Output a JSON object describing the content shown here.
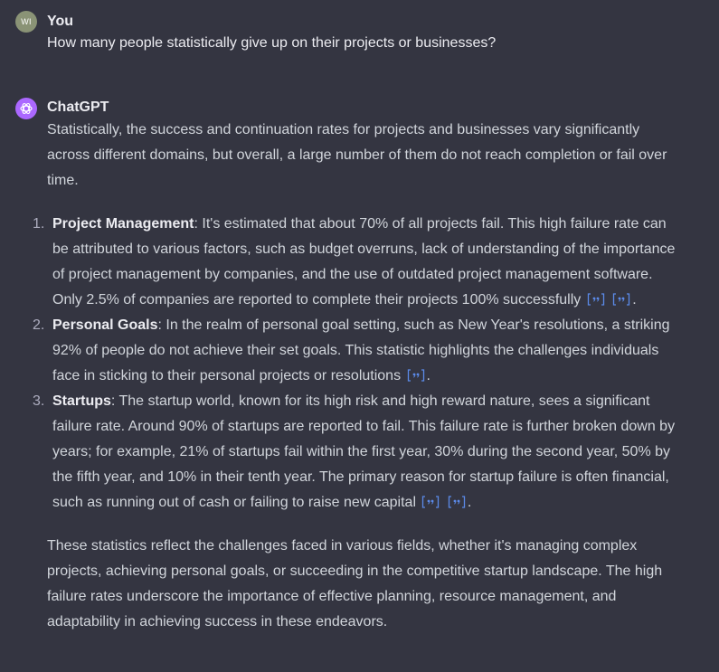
{
  "user": {
    "initials": "WI",
    "name": "You",
    "message": "How many people statistically give up on their projects or businesses?"
  },
  "assistant": {
    "name": "ChatGPT",
    "intro": "Statistically, the success and continuation rates for projects and businesses vary significantly across different domains, but overall, a large number of them do not reach completion or fail over time.",
    "items": [
      {
        "number": "1.",
        "term": "Project Management",
        "text": ": It's estimated that about 70% of all projects fail. This high failure rate can be attributed to various factors, such as budget overruns, lack of understanding of the importance of project management by companies, and the use of outdated project management software. Only 2.5% of companies are reported to complete their projects 100% successfully"
      },
      {
        "number": "2.",
        "term": "Personal Goals",
        "text": ": In the realm of personal goal setting, such as New Year's resolutions, a striking 92% of people do not achieve their set goals. This statistic highlights the challenges individuals face in sticking to their personal projects or resolutions"
      },
      {
        "number": "3.",
        "term": "Startups",
        "text": ": The startup world, known for its high risk and high reward nature, sees a significant failure rate. Around 90% of startups are reported to fail. This failure rate is further broken down by years; for example, 21% of startups fail within the first year, 30% during the second year, 50% by the fifth year, and 10% in their tenth year. The primary reason for startup failure is often financial, such as running out of cash or failing to raise new capital"
      }
    ],
    "end_punct": ".",
    "conclusion": "These statistics reflect the challenges faced in various fields, whether it's managing complex projects, achieving personal goals, or succeeding in the competitive startup landscape. The high failure rates underscore the importance of effective planning, resource management, and adaptability in achieving success in these endeavors."
  },
  "colors": {
    "background": "#343541",
    "text": "#d1d5db",
    "heading": "#ececf1",
    "citation": "#5b8ae8",
    "user_avatar": "#8a9376",
    "assistant_avatar": "#ab68ff"
  },
  "icons": {
    "citation": "quote-citation-icon",
    "assistant": "openai-logo-icon"
  }
}
